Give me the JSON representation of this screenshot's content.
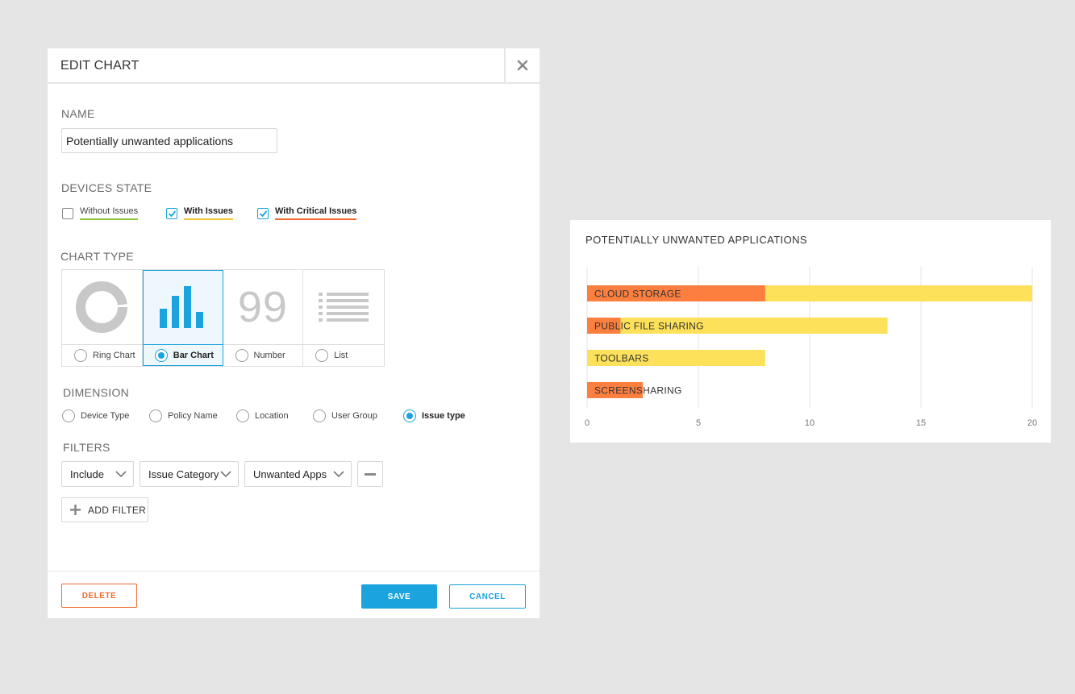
{
  "dialog": {
    "title": "EDIT CHART",
    "close_icon": "close-icon",
    "name_section": {
      "label": "NAME",
      "value": "Potentially unwanted applications"
    },
    "devices_state": {
      "label": "DEVICES STATE",
      "options": [
        {
          "label": "Without Issues",
          "checked": false,
          "underline_color": "#8cc63f"
        },
        {
          "label": "With Issues",
          "checked": true,
          "underline_color": "#f5c42c"
        },
        {
          "label": "With Critical Issues",
          "checked": true,
          "underline_color": "#ee6a2c"
        }
      ]
    },
    "chart_type": {
      "label": "CHART TYPE",
      "options": [
        {
          "label": "Ring Chart",
          "icon": "ring-chart-icon",
          "selected": false
        },
        {
          "label": "Bar Chart",
          "icon": "bar-chart-icon",
          "selected": true
        },
        {
          "label": "Number",
          "icon": "number-icon",
          "glyph": "99",
          "selected": false
        },
        {
          "label": "List",
          "icon": "list-icon",
          "selected": false
        }
      ]
    },
    "dimension": {
      "label": "DIMENSION",
      "options": [
        {
          "label": "Device Type",
          "selected": false
        },
        {
          "label": "Policy Name",
          "selected": false
        },
        {
          "label": "Location",
          "selected": false
        },
        {
          "label": "User Group",
          "selected": false
        },
        {
          "label": "Issue type",
          "selected": true
        }
      ]
    },
    "filters": {
      "label": "FILTERS",
      "selects": [
        "Include",
        "Issue Category",
        "Unwanted Apps"
      ],
      "add_filter_label": "ADD FILTER"
    },
    "footer": {
      "delete_label": "DELETE",
      "save_label": "SAVE",
      "cancel_label": "CANCEL"
    }
  },
  "colors": {
    "accent": "#1aa3dc",
    "critical": "#ee6a2c",
    "issues": "#fde15a",
    "chart_critical": "#fd7f3f"
  },
  "chart_panel": {
    "title": "POTENTIALLY UNWANTED APPLICATIONS"
  },
  "chart_data": {
    "type": "bar",
    "orientation": "horizontal",
    "stacked": false,
    "title": "POTENTIALLY UNWANTED APPLICATIONS",
    "categories": [
      "CLOUD STORAGE",
      "PUBLIC FILE SHARING",
      "TOOLBARS",
      "SCREENSHARING"
    ],
    "series": [
      {
        "values": [
          20,
          13.5,
          8,
          2.5
        ]
      },
      {
        "values": [
          8,
          1.5,
          0,
          2.5
        ]
      }
    ],
    "xlim": [
      0,
      20
    ],
    "xticks": [
      0,
      5,
      10,
      15,
      20
    ],
    "grid": true,
    "legend": "none"
  }
}
